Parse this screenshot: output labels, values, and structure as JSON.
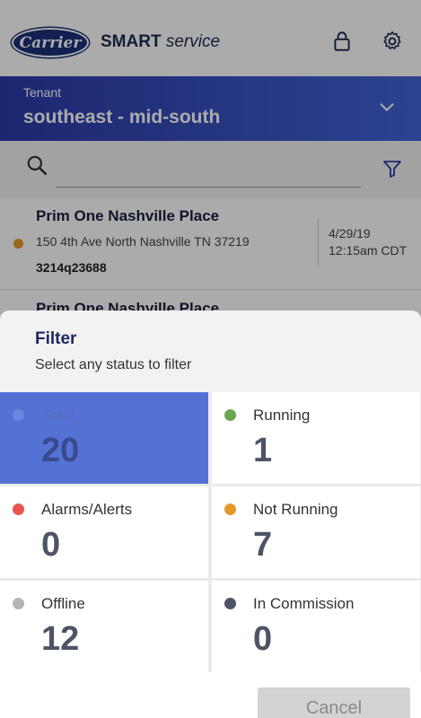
{
  "app": {
    "logo_text": "Carrier",
    "title_bold": "SMART",
    "title_italic": " service",
    "icons": [
      "lock-icon",
      "gear-icon"
    ]
  },
  "tenant": {
    "label": "Tenant",
    "value": "southeast - mid-south",
    "chevron_icon": "chevron-down-icon"
  },
  "search": {
    "value": "",
    "placeholder": "",
    "icon": "search-icon",
    "filter_icon": "filter-icon"
  },
  "list": {
    "items": [
      {
        "name": "Prim One Nashville Place",
        "address": "150 4th Ave North Nashville  TN 37219",
        "id": "3214q23688",
        "date": "4/29/19",
        "time": "12:15am CDT",
        "status_color": "#e49a2b"
      },
      {
        "name": "Prim One Nashville Place"
      }
    ]
  },
  "filter": {
    "title": "Filter",
    "subtitle": "Select any status to filter",
    "statuses": [
      {
        "label": "Total",
        "count": "20",
        "color": "#6a87e0",
        "selected": true
      },
      {
        "label": "Running",
        "count": "1",
        "color": "#6aa84f",
        "selected": false
      },
      {
        "label": "Alarms/Alerts",
        "count": "0",
        "color": "#e8554e",
        "selected": false
      },
      {
        "label": "Not Running",
        "count": "7",
        "color": "#e49a2b",
        "selected": false
      },
      {
        "label": "Offline",
        "count": "12",
        "color": "#b5b5b5",
        "selected": false
      },
      {
        "label": "In Commission",
        "count": "0",
        "color": "#4c5466",
        "selected": false
      }
    ],
    "cancel_label": "Cancel"
  },
  "colors": {
    "tenant_gradient_start": "#2c3aa8",
    "tenant_gradient_end": "#4364d6",
    "selected_cell": "#5472d3",
    "title_navy": "#1d2863"
  }
}
